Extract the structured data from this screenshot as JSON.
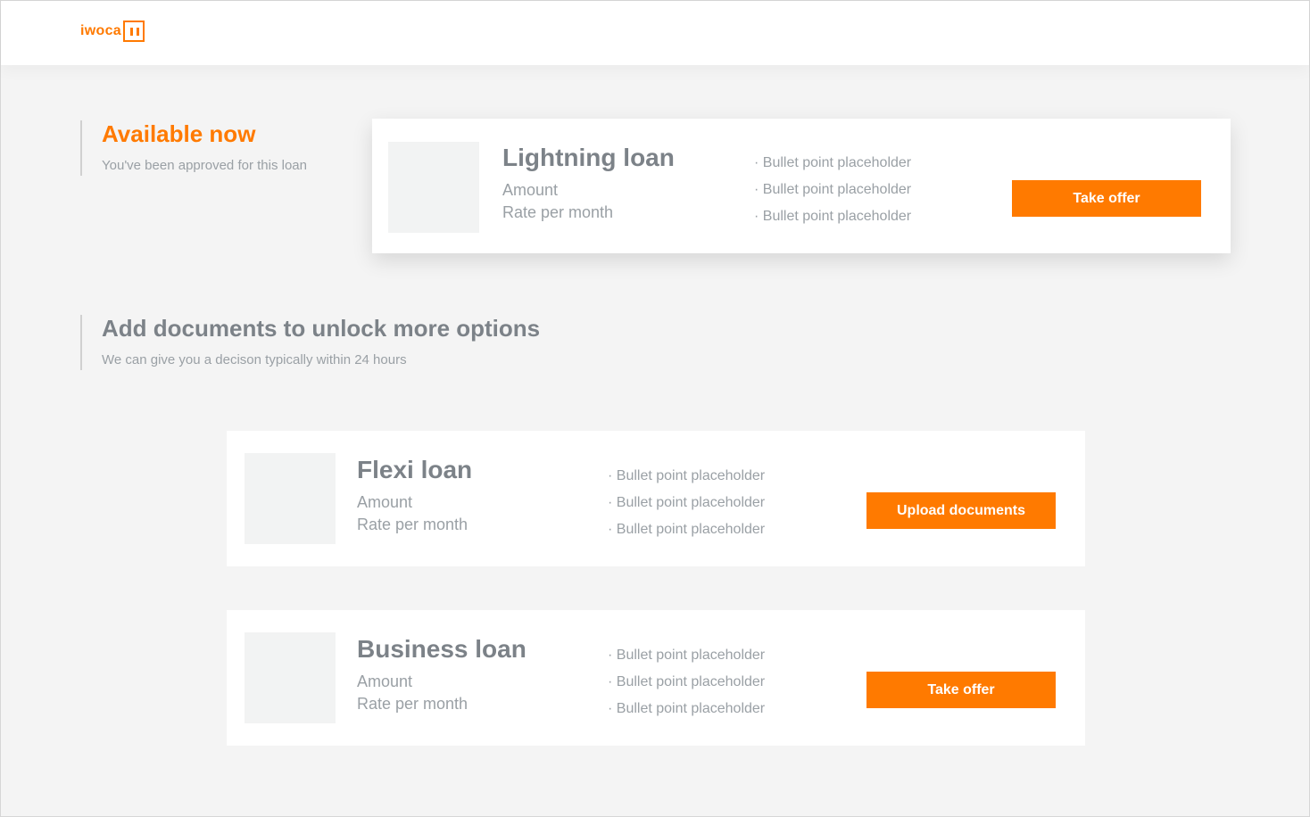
{
  "header": {
    "logo_text": "iwoca",
    "brand_color": "#ff7a00"
  },
  "available": {
    "title": "Available now",
    "subtitle": "You've been approved for this loan"
  },
  "unlock": {
    "title": "Add documents to unlock more options",
    "subtitle": "We can give you a decison typically within 24 hours"
  },
  "loans": [
    {
      "name": "Lightning loan",
      "amount_label": "Amount",
      "rate_label": "Rate per month",
      "bullets": [
        "Bullet point placeholder",
        "Bullet point placeholder",
        "Bullet point placeholder"
      ],
      "button_label": "Take offer"
    },
    {
      "name": "Flexi loan",
      "amount_label": "Amount",
      "rate_label": "Rate per month",
      "bullets": [
        "Bullet point placeholder",
        "Bullet point placeholder",
        "Bullet point placeholder"
      ],
      "button_label": "Upload documents"
    },
    {
      "name": "Business loan",
      "amount_label": "Amount",
      "rate_label": "Rate per month",
      "bullets": [
        "Bullet point placeholder",
        "Bullet point placeholder",
        "Bullet point placeholder"
      ],
      "button_label": "Take offer"
    }
  ]
}
